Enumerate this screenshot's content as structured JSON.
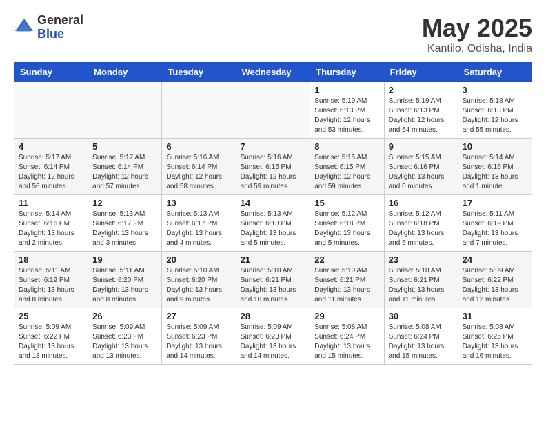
{
  "header": {
    "logo_general": "General",
    "logo_blue": "Blue",
    "month_title": "May 2025",
    "location": "Kantilo, Odisha, India"
  },
  "weekdays": [
    "Sunday",
    "Monday",
    "Tuesday",
    "Wednesday",
    "Thursday",
    "Friday",
    "Saturday"
  ],
  "weeks": [
    [
      {
        "day": "",
        "info": ""
      },
      {
        "day": "",
        "info": ""
      },
      {
        "day": "",
        "info": ""
      },
      {
        "day": "",
        "info": ""
      },
      {
        "day": "1",
        "info": "Sunrise: 5:19 AM\nSunset: 6:13 PM\nDaylight: 12 hours\nand 53 minutes."
      },
      {
        "day": "2",
        "info": "Sunrise: 5:19 AM\nSunset: 6:13 PM\nDaylight: 12 hours\nand 54 minutes."
      },
      {
        "day": "3",
        "info": "Sunrise: 5:18 AM\nSunset: 6:13 PM\nDaylight: 12 hours\nand 55 minutes."
      }
    ],
    [
      {
        "day": "4",
        "info": "Sunrise: 5:17 AM\nSunset: 6:14 PM\nDaylight: 12 hours\nand 56 minutes."
      },
      {
        "day": "5",
        "info": "Sunrise: 5:17 AM\nSunset: 6:14 PM\nDaylight: 12 hours\nand 57 minutes."
      },
      {
        "day": "6",
        "info": "Sunrise: 5:16 AM\nSunset: 6:14 PM\nDaylight: 12 hours\nand 58 minutes."
      },
      {
        "day": "7",
        "info": "Sunrise: 5:16 AM\nSunset: 6:15 PM\nDaylight: 12 hours\nand 59 minutes."
      },
      {
        "day": "8",
        "info": "Sunrise: 5:15 AM\nSunset: 6:15 PM\nDaylight: 12 hours\nand 59 minutes."
      },
      {
        "day": "9",
        "info": "Sunrise: 5:15 AM\nSunset: 6:16 PM\nDaylight: 13 hours\nand 0 minutes."
      },
      {
        "day": "10",
        "info": "Sunrise: 5:14 AM\nSunset: 6:16 PM\nDaylight: 13 hours\nand 1 minute."
      }
    ],
    [
      {
        "day": "11",
        "info": "Sunrise: 5:14 AM\nSunset: 6:16 PM\nDaylight: 13 hours\nand 2 minutes."
      },
      {
        "day": "12",
        "info": "Sunrise: 5:13 AM\nSunset: 6:17 PM\nDaylight: 13 hours\nand 3 minutes."
      },
      {
        "day": "13",
        "info": "Sunrise: 5:13 AM\nSunset: 6:17 PM\nDaylight: 13 hours\nand 4 minutes."
      },
      {
        "day": "14",
        "info": "Sunrise: 5:13 AM\nSunset: 6:18 PM\nDaylight: 13 hours\nand 5 minutes."
      },
      {
        "day": "15",
        "info": "Sunrise: 5:12 AM\nSunset: 6:18 PM\nDaylight: 13 hours\nand 5 minutes."
      },
      {
        "day": "16",
        "info": "Sunrise: 5:12 AM\nSunset: 6:18 PM\nDaylight: 13 hours\nand 6 minutes."
      },
      {
        "day": "17",
        "info": "Sunrise: 5:11 AM\nSunset: 6:19 PM\nDaylight: 13 hours\nand 7 minutes."
      }
    ],
    [
      {
        "day": "18",
        "info": "Sunrise: 5:11 AM\nSunset: 6:19 PM\nDaylight: 13 hours\nand 8 minutes."
      },
      {
        "day": "19",
        "info": "Sunrise: 5:11 AM\nSunset: 6:20 PM\nDaylight: 13 hours\nand 8 minutes."
      },
      {
        "day": "20",
        "info": "Sunrise: 5:10 AM\nSunset: 6:20 PM\nDaylight: 13 hours\nand 9 minutes."
      },
      {
        "day": "21",
        "info": "Sunrise: 5:10 AM\nSunset: 6:21 PM\nDaylight: 13 hours\nand 10 minutes."
      },
      {
        "day": "22",
        "info": "Sunrise: 5:10 AM\nSunset: 6:21 PM\nDaylight: 13 hours\nand 11 minutes."
      },
      {
        "day": "23",
        "info": "Sunrise: 5:10 AM\nSunset: 6:21 PM\nDaylight: 13 hours\nand 11 minutes."
      },
      {
        "day": "24",
        "info": "Sunrise: 5:09 AM\nSunset: 6:22 PM\nDaylight: 13 hours\nand 12 minutes."
      }
    ],
    [
      {
        "day": "25",
        "info": "Sunrise: 5:09 AM\nSunset: 6:22 PM\nDaylight: 13 hours\nand 13 minutes."
      },
      {
        "day": "26",
        "info": "Sunrise: 5:09 AM\nSunset: 6:23 PM\nDaylight: 13 hours\nand 13 minutes."
      },
      {
        "day": "27",
        "info": "Sunrise: 5:09 AM\nSunset: 6:23 PM\nDaylight: 13 hours\nand 14 minutes."
      },
      {
        "day": "28",
        "info": "Sunrise: 5:09 AM\nSunset: 6:23 PM\nDaylight: 13 hours\nand 14 minutes."
      },
      {
        "day": "29",
        "info": "Sunrise: 5:08 AM\nSunset: 6:24 PM\nDaylight: 13 hours\nand 15 minutes."
      },
      {
        "day": "30",
        "info": "Sunrise: 5:08 AM\nSunset: 6:24 PM\nDaylight: 13 hours\nand 15 minutes."
      },
      {
        "day": "31",
        "info": "Sunrise: 5:08 AM\nSunset: 6:25 PM\nDaylight: 13 hours\nand 16 minutes."
      }
    ]
  ]
}
